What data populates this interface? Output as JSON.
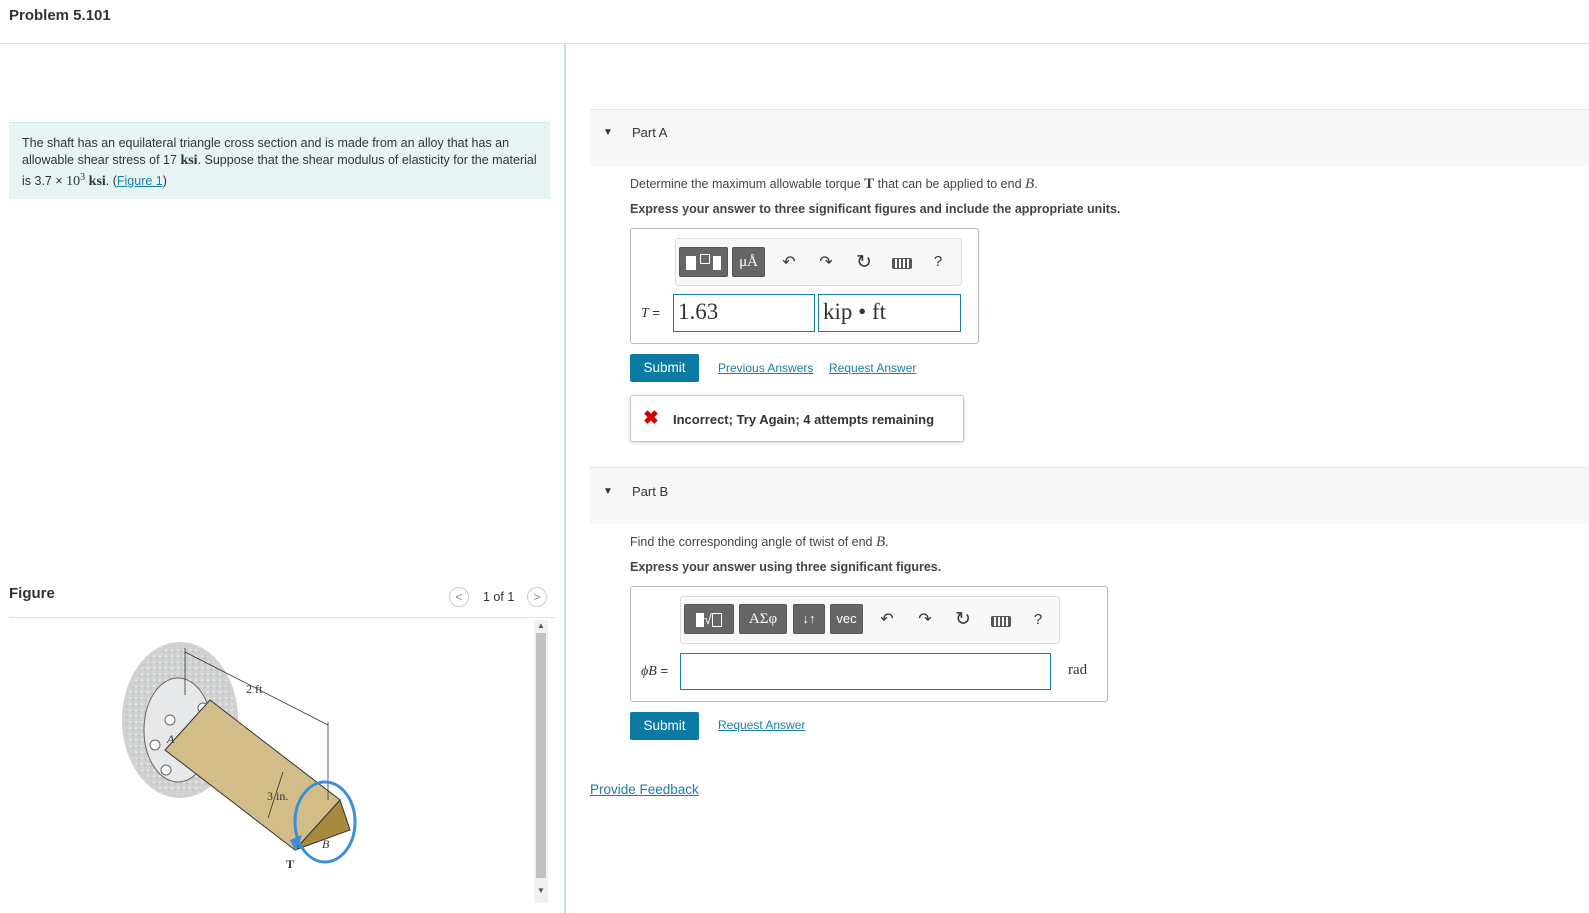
{
  "header": {
    "title": "Problem 5.101"
  },
  "problem": {
    "text_1": "The shaft has an equilateral triangle cross section and is made from an alloy that has an allowable shear stress of 17",
    "unit_ksi": "ksi",
    "text_2": ". Suppose that the shear modulus of elasticity for the material is 3.7",
    "times": "×",
    "power_base": "10",
    "power_exp": "3",
    "unit_ksi_2": "ksi",
    "text_3": ". (",
    "figure_link": "Figure 1",
    "text_4": ")"
  },
  "figure": {
    "label": "Figure",
    "pager_text": "1 of 1",
    "prev_icon": "chevron-left-icon",
    "next_icon": "chevron-right-icon",
    "dims": {
      "length": "2 ft",
      "side": "3 in.",
      "end_a": "A",
      "end_b": "B",
      "torque": "T"
    }
  },
  "partA": {
    "title": "Part A",
    "prompt_1": "Determine the maximum allowable torque",
    "prompt_sym": "T",
    "prompt_2": "that can be applied to end",
    "prompt_end": "B",
    "prompt_3": ".",
    "instruction": "Express your answer to three significant figures and include the appropriate units.",
    "toolbar": {
      "mu": "μÅ",
      "help": "?"
    },
    "var_label": "T",
    "eq": "=",
    "value": "1.63",
    "units": "kip • ft",
    "submit": "Submit",
    "prev_answers": "Previous Answers",
    "request_answer": "Request Answer",
    "feedback": "Incorrect; Try Again; 4 attempts remaining",
    "feedback_icon": "x-mark-icon"
  },
  "partB": {
    "title": "Part B",
    "prompt_1": "Find the corresponding angle of twist of end",
    "prompt_end": "B",
    "prompt_2": ".",
    "instruction": "Express your answer using three significant figures.",
    "toolbar": {
      "greek": "ΑΣφ",
      "arrows": "↓↑",
      "vec": "vec",
      "help": "?"
    },
    "var_label": "ϕB",
    "eq": "=",
    "value": "",
    "units": "rad",
    "submit": "Submit",
    "request_answer": "Request Answer"
  },
  "footer": {
    "provide_feedback": "Provide Feedback"
  },
  "colors": {
    "accent": "#0c7aa2",
    "problem_bg": "#e6f4f4",
    "error": "#d40000"
  }
}
